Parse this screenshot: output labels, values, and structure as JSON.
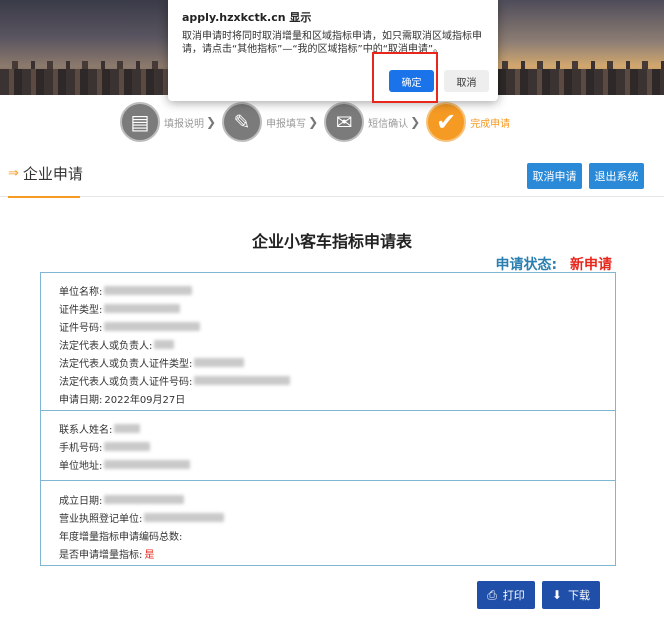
{
  "dialog": {
    "title": "apply.hzxkctk.cn 显示",
    "message": "取消申请时将同时取消增量和区域指标申请，如只需取消区域指标申请，请点击“其他指标”—“我的区域指标”中的“取消申请”。",
    "ok_label": "确定",
    "cancel_label": "取消"
  },
  "steps": [
    {
      "label": "填报说明",
      "icon": "clipboard-icon"
    },
    {
      "label": "申报填写",
      "icon": "pencil-icon"
    },
    {
      "label": "短信确认",
      "icon": "message-icon"
    },
    {
      "label": "完成申请",
      "icon": "checkmark-icon"
    }
  ],
  "header": {
    "tab_title": "企业申请",
    "cancel_apply_label": "取消申请",
    "exit_label": "退出系统"
  },
  "form": {
    "title": "企业小客车指标申请表",
    "status_label": "申请状态:",
    "status_value": "新申请",
    "section1": {
      "unit_name_label": "单位名称:",
      "cert_type_label": "证件类型:",
      "cert_no_label": "证件号码:",
      "legal_rep_label": "法定代表人或负责人:",
      "legal_cert_type_label": "法定代表人或负责人证件类型:",
      "legal_cert_no_label": "法定代表人或负责人证件号码:",
      "apply_date_label": "申请日期:",
      "apply_date_value": "2022年09月27日"
    },
    "section2": {
      "contact_name_label": "联系人姓名:",
      "phone_label": "手机号码:",
      "address_label": "单位地址:"
    },
    "section3": {
      "established_label": "成立日期:",
      "registration_unit_label": "营业执照登记单位:",
      "annual_count_label": "年度增量指标申请编码总数:",
      "apply_increment_label": "是否申请增量指标:",
      "apply_increment_value": "是"
    }
  },
  "actions": {
    "print_label": "打印",
    "download_label": "下载"
  },
  "colors": {
    "accent_orange": "#f59a23",
    "primary_blue": "#2a8ad8",
    "dark_blue": "#1f4fa8",
    "status_red": "#e8261c"
  }
}
